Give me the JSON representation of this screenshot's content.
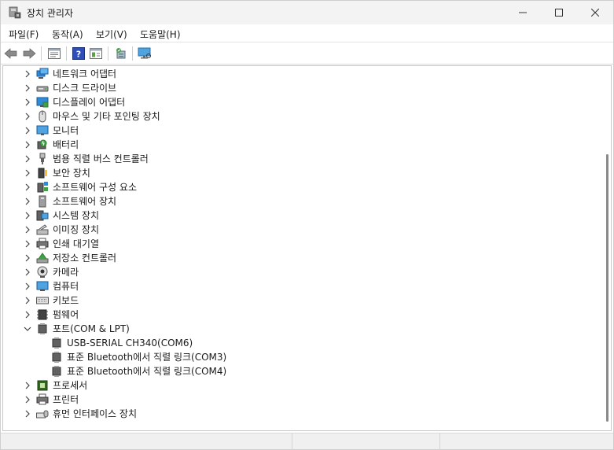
{
  "window": {
    "title": "장치 관리자",
    "icon": "device-manager-icon"
  },
  "menu": [
    {
      "label": "파일(F)"
    },
    {
      "label": "동작(A)"
    },
    {
      "label": "보기(V)"
    },
    {
      "label": "도움말(H)"
    }
  ],
  "toolbar": [
    {
      "icon": "back-arrow-icon"
    },
    {
      "icon": "forward-arrow-icon"
    },
    {
      "icon": "properties-icon"
    },
    {
      "icon": "help-icon"
    },
    {
      "icon": "show-hidden-icon"
    },
    {
      "icon": "update-driver-icon"
    },
    {
      "icon": "scan-hardware-icon"
    }
  ],
  "tree": {
    "nodes": [
      {
        "label": "네트워크 어댑터",
        "icon": "network-adapter-icon",
        "expanded": false
      },
      {
        "label": "디스크 드라이브",
        "icon": "disk-drive-icon",
        "expanded": false
      },
      {
        "label": "디스플레이 어댑터",
        "icon": "display-adapter-icon",
        "expanded": false
      },
      {
        "label": "마우스 및 기타 포인팅 장치",
        "icon": "mouse-icon",
        "expanded": false
      },
      {
        "label": "모니터",
        "icon": "monitor-icon",
        "expanded": false
      },
      {
        "label": "배터리",
        "icon": "battery-icon",
        "expanded": false
      },
      {
        "label": "범용 직렬 버스 컨트롤러",
        "icon": "usb-controller-icon",
        "expanded": false
      },
      {
        "label": "보안 장치",
        "icon": "security-device-icon",
        "expanded": false
      },
      {
        "label": "소프트웨어 구성 요소",
        "icon": "software-component-icon",
        "expanded": false
      },
      {
        "label": "소프트웨어 장치",
        "icon": "software-device-icon",
        "expanded": false
      },
      {
        "label": "시스템 장치",
        "icon": "system-device-icon",
        "expanded": false
      },
      {
        "label": "이미징 장치",
        "icon": "imaging-device-icon",
        "expanded": false
      },
      {
        "label": "인쇄 대기열",
        "icon": "print-queue-icon",
        "expanded": false
      },
      {
        "label": "저장소 컨트롤러",
        "icon": "storage-controller-icon",
        "expanded": false
      },
      {
        "label": "카메라",
        "icon": "camera-icon",
        "expanded": false
      },
      {
        "label": "컴퓨터",
        "icon": "computer-icon",
        "expanded": false
      },
      {
        "label": "키보드",
        "icon": "keyboard-icon",
        "expanded": false
      },
      {
        "label": "펌웨어",
        "icon": "firmware-icon",
        "expanded": false
      },
      {
        "label": "포트(COM & LPT)",
        "icon": "port-icon",
        "expanded": true,
        "children": [
          {
            "label": "USB-SERIAL CH340(COM6)",
            "icon": "port-icon"
          },
          {
            "label": "표준 Bluetooth에서 직렬 링크(COM3)",
            "icon": "port-icon"
          },
          {
            "label": "표준 Bluetooth에서 직렬 링크(COM4)",
            "icon": "port-icon"
          }
        ]
      },
      {
        "label": "프로세서",
        "icon": "processor-icon",
        "expanded": false
      },
      {
        "label": "프린터",
        "icon": "printer-icon",
        "expanded": false
      },
      {
        "label": "휴먼 인터페이스 장치",
        "icon": "hid-icon",
        "expanded": false
      }
    ]
  },
  "colors": {
    "accent": "#1e88e5",
    "titlebar": "#f3f3f3",
    "statusbar": "#f0f0f0"
  }
}
